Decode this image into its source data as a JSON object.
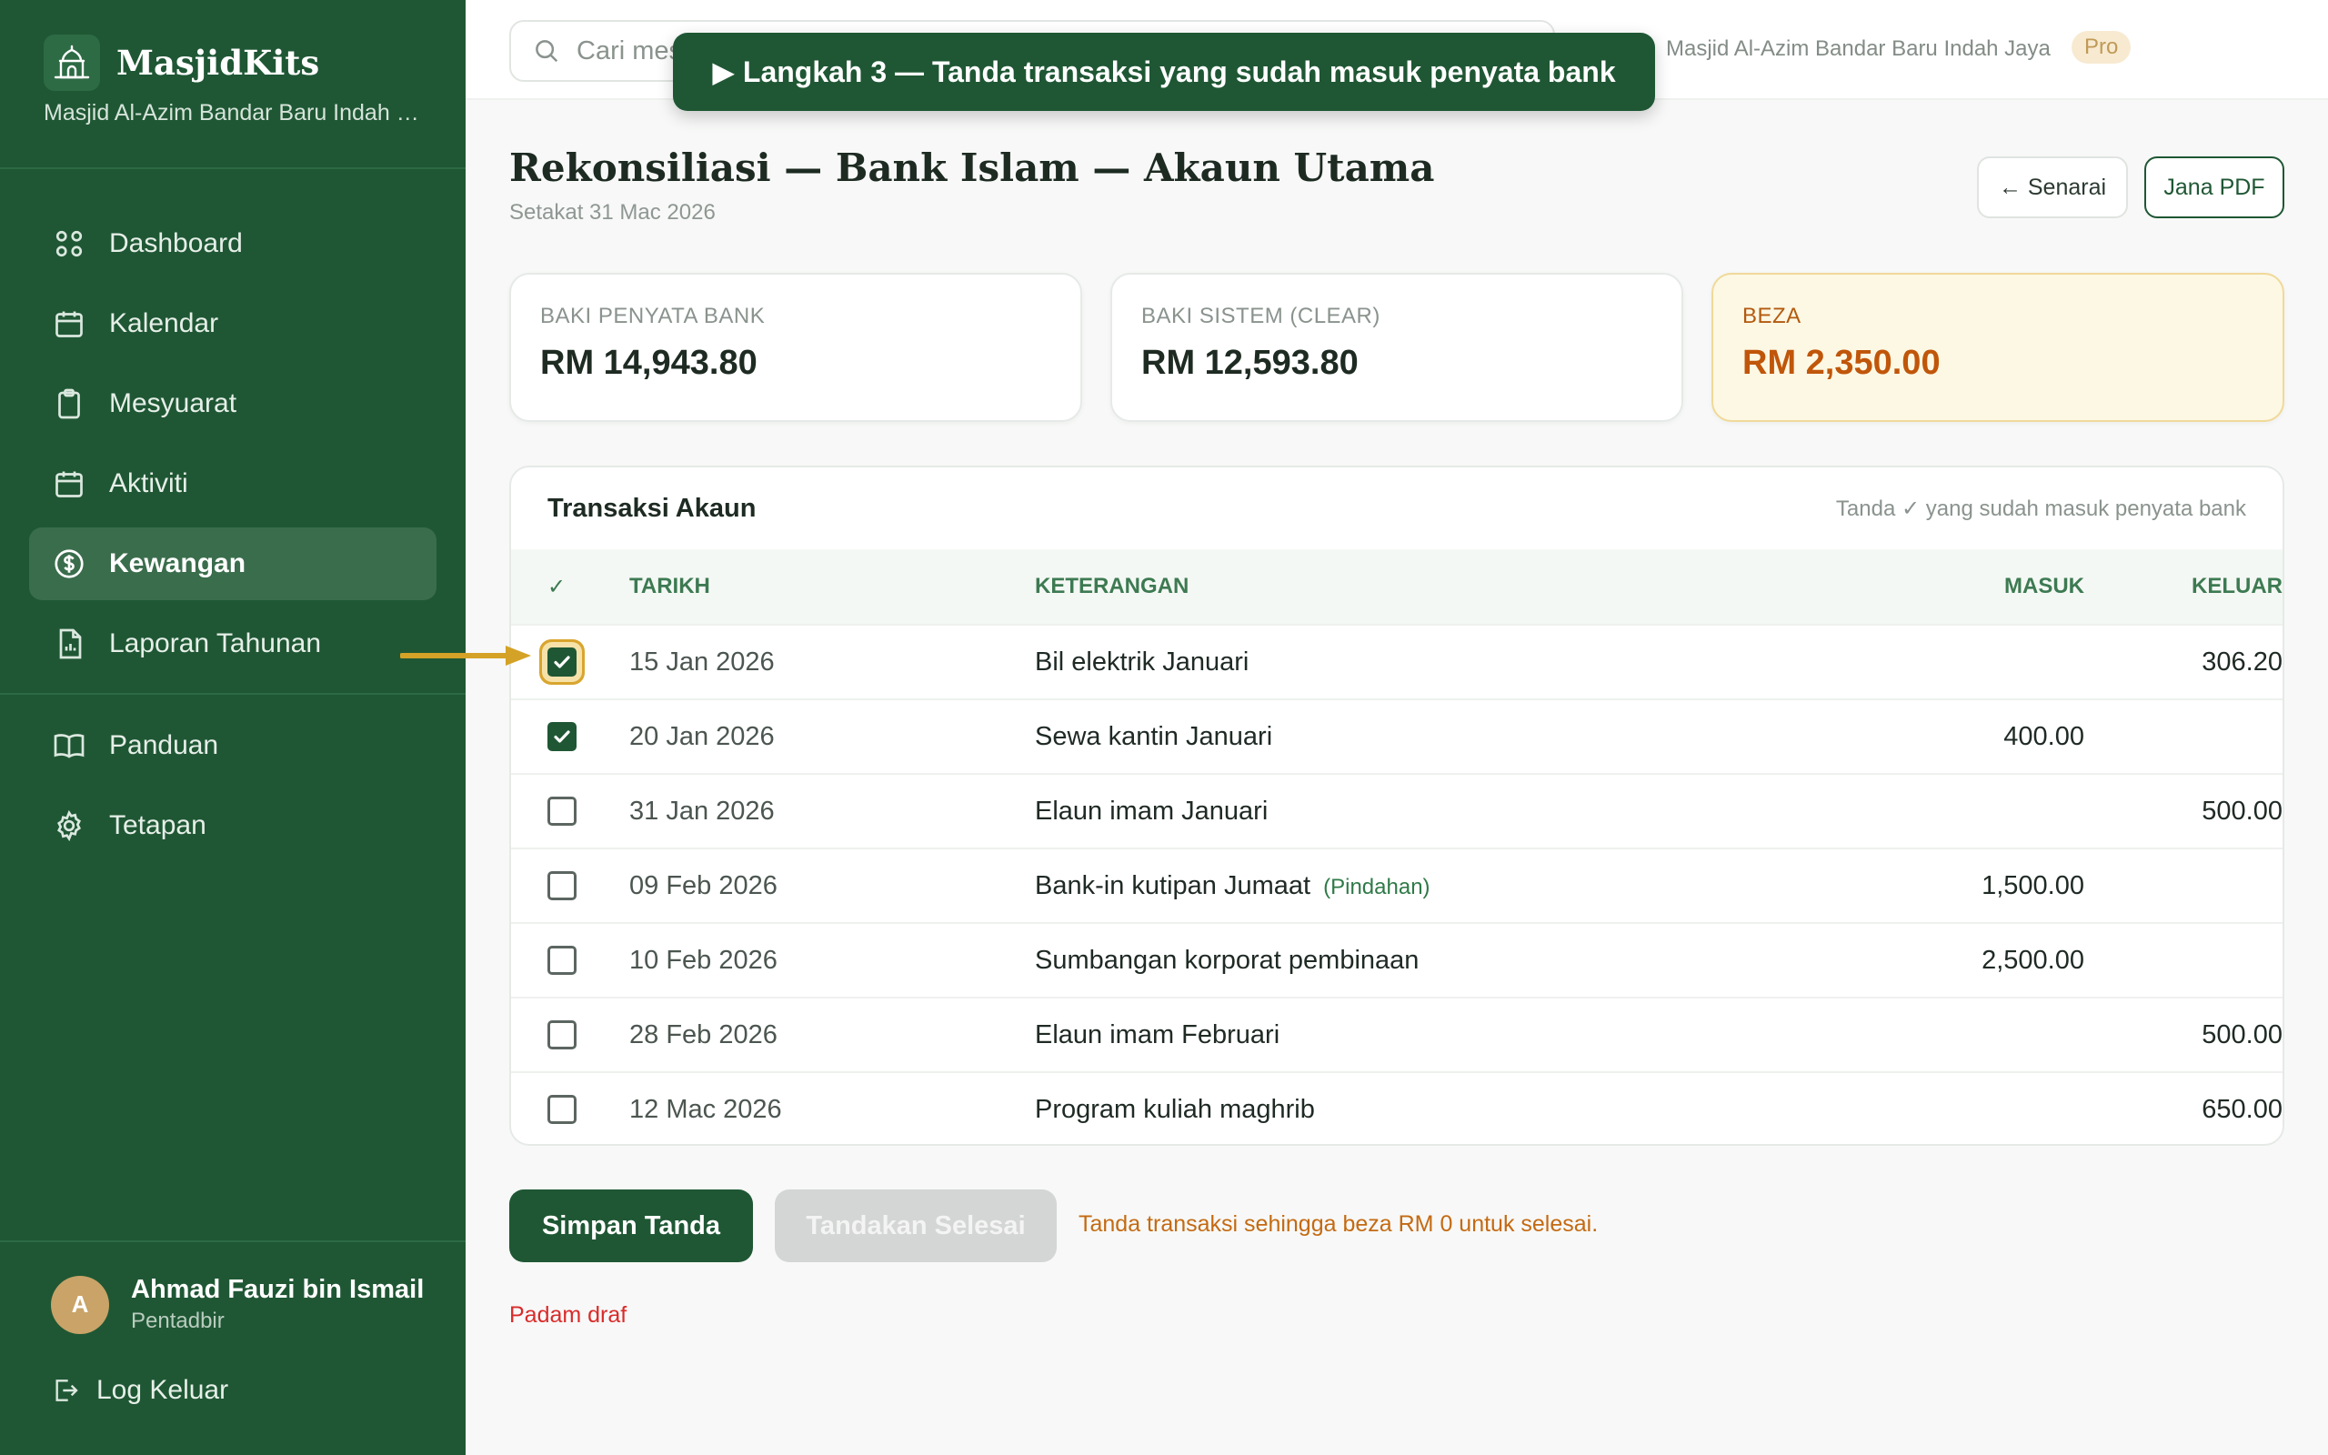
{
  "sidebar": {
    "brand_name": "MasjidKits",
    "brand_sub": "Masjid Al-Azim Bandar Baru Indah J...",
    "items": [
      {
        "label": "Dashboard",
        "icon": "grid-icon"
      },
      {
        "label": "Kalendar",
        "icon": "calendar-icon"
      },
      {
        "label": "Mesyuarat",
        "icon": "clipboard-icon"
      },
      {
        "label": "Aktiviti",
        "icon": "calendar-icon"
      },
      {
        "label": "Kewangan",
        "icon": "dollar-icon",
        "active": true
      },
      {
        "label": "Laporan Tahunan",
        "icon": "report-icon"
      }
    ],
    "items2": [
      {
        "label": "Panduan",
        "icon": "book-icon"
      },
      {
        "label": "Tetapan",
        "icon": "gear-icon"
      }
    ],
    "user": {
      "initial": "A",
      "name": "Ahmad Fauzi bin Ismail",
      "role": "Pentadbir"
    },
    "logout_label": "Log Keluar"
  },
  "topbar": {
    "search_placeholder": "Cari mes",
    "org_name": "Masjid Al-Azim Bandar Baru Indah Jaya",
    "plan_badge": "Pro"
  },
  "tour": {
    "text": "▶ Langkah 3 — Tanda transaksi yang sudah masuk penyata bank"
  },
  "header": {
    "title": "Rekonsiliasi — Bank Islam — Akaun Utama",
    "subtitle": "Setakat 31 Mac 2026",
    "back_label": "← Senarai",
    "pdf_label": "Jana PDF"
  },
  "cards": [
    {
      "label": "BAKI PENYATA BANK",
      "value": "RM 14,943.80"
    },
    {
      "label": "BAKI SISTEM (CLEAR)",
      "value": "RM 12,593.80"
    },
    {
      "label": "BEZA",
      "value": "RM 2,350.00"
    }
  ],
  "table": {
    "title": "Transaksi Akaun",
    "hint": "Tanda ✓ yang sudah masuk penyata bank",
    "columns": {
      "check": "✓",
      "date": "TARIKH",
      "desc": "KETERANGAN",
      "in": "MASUK",
      "out": "KELUAR"
    },
    "rows": [
      {
        "checked": true,
        "date": "15 Jan 2026",
        "desc": "Bil elektrik Januari",
        "tag": "",
        "in": "",
        "out": "306.20"
      },
      {
        "checked": true,
        "date": "20 Jan 2026",
        "desc": "Sewa kantin Januari",
        "tag": "",
        "in": "400.00",
        "out": ""
      },
      {
        "checked": false,
        "date": "31 Jan 2026",
        "desc": "Elaun imam Januari",
        "tag": "",
        "in": "",
        "out": "500.00"
      },
      {
        "checked": false,
        "date": "09 Feb 2026",
        "desc": "Bank-in kutipan Jumaat",
        "tag": "(Pindahan)",
        "in": "1,500.00",
        "out": ""
      },
      {
        "checked": false,
        "date": "10 Feb 2026",
        "desc": "Sumbangan korporat pembinaan",
        "tag": "",
        "in": "2,500.00",
        "out": ""
      },
      {
        "checked": false,
        "date": "28 Feb 2026",
        "desc": "Elaun imam Februari",
        "tag": "",
        "in": "",
        "out": "500.00"
      },
      {
        "checked": false,
        "date": "12 Mac 2026",
        "desc": "Program kuliah maghrib",
        "tag": "",
        "in": "",
        "out": "650.00"
      }
    ]
  },
  "actions": {
    "save_label": "Simpan Tanda",
    "done_label": "Tandakan Selesai",
    "done_hint": "Tanda transaksi sehingga beza RM 0 untuk selesai.",
    "delete_draft": "Padam draf"
  },
  "colors": {
    "brand_green": "#1f5734",
    "accent_orange": "#c0560a",
    "highlight": "#d9a52e"
  }
}
